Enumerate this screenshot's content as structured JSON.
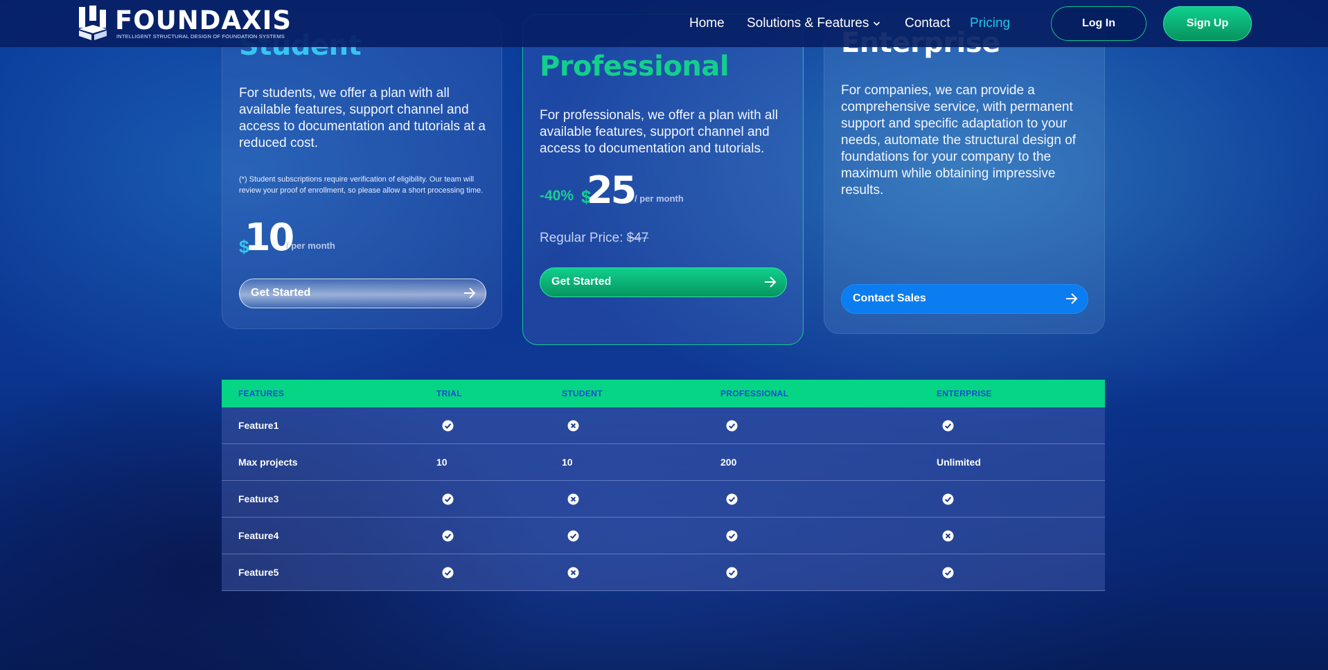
{
  "brand": {
    "name": "FOUNDAXIS",
    "tagline": "INTELLIGENT STRUCTURAL DESIGN OF FOUNDATION SYSTEMS"
  },
  "nav": {
    "links": [
      "Home",
      "Solutions & Features",
      "Contact",
      "Pricing"
    ],
    "active": "Pricing",
    "login_label": "Log In",
    "signup_label": "Sign Up"
  },
  "colors": {
    "accent_green": "#05d585",
    "accent_blue": "#0c7df0",
    "accent_cyan": "#22c5e8",
    "table_header_text": "#1f48d6"
  },
  "plans": {
    "student": {
      "title": "Student",
      "description": "For students, we offer a plan with all available features, support channel and access to documentation and tutorials at a reduced cost.",
      "note": "(*) Student subscriptions require verification of eligibility. Our team will review your proof of enrollment, so please allow a short processing time.",
      "currency": "$",
      "price": "10",
      "period": "/ per month",
      "cta_label": "Get Started"
    },
    "professional": {
      "title": "Professional",
      "description": "For professionals, we offer a plan with all available features, support channel and access to documentation and tutorials.",
      "discount": "-40%",
      "currency": "$",
      "price": "25",
      "period": "/ per month",
      "regular_label": "Regular Price:",
      "regular_price": "$47",
      "cta_label": "Get Started"
    },
    "enterprise": {
      "title": "Enterprise",
      "description": "For companies, we can provide a comprehensive service, with permanent support and specific adaptation to your needs, automate the structural design of foundations for your company to the maximum while obtaining impressive results.",
      "cta_label": "Contact Sales"
    }
  },
  "features_table": {
    "headers": [
      "FEATURES",
      "TRIAL",
      "STUDENT",
      "PROFESSIONAL",
      "ENTERPRISE"
    ],
    "rows": [
      {
        "name": "Feature1",
        "trial": "check",
        "student": "cross",
        "professional": "check",
        "enterprise": "check"
      },
      {
        "name": "Max projects",
        "trial": "10",
        "student": "10",
        "professional": "200",
        "enterprise": "Unlimited"
      },
      {
        "name": "Feature3",
        "trial": "check",
        "student": "cross",
        "professional": "check",
        "enterprise": "check"
      },
      {
        "name": "Feature4",
        "trial": "check",
        "student": "check",
        "professional": "check",
        "enterprise": "cross"
      },
      {
        "name": "Feature5",
        "trial": "check",
        "student": "cross",
        "professional": "check",
        "enterprise": "check"
      }
    ]
  }
}
